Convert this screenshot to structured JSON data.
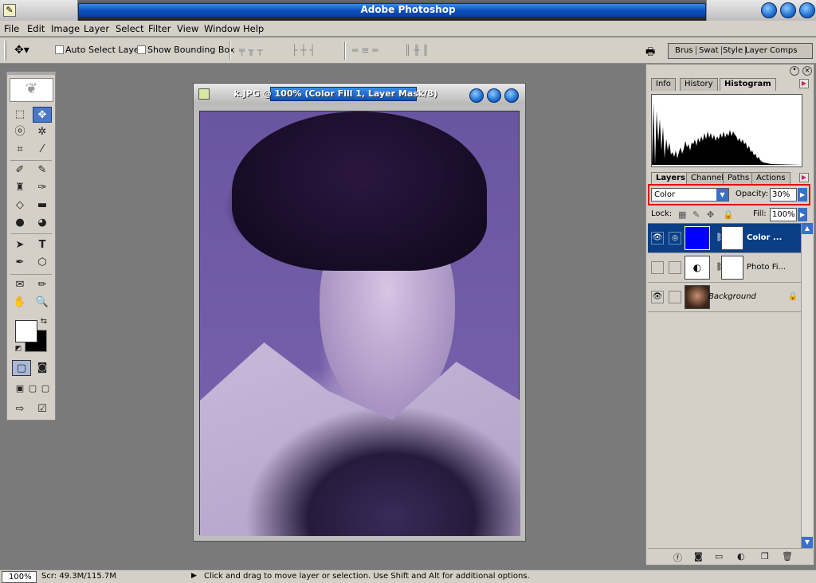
{
  "app": {
    "title": "Adobe Photoshop"
  },
  "menu": [
    "File",
    "Edit",
    "Image",
    "Layer",
    "Select",
    "Filter",
    "View",
    "Window",
    "Help"
  ],
  "options": {
    "auto_select_layer": "Auto Select Layer",
    "show_bounding_box": "Show Bounding Box"
  },
  "palette_well": [
    "Brus",
    "Swat",
    "Style",
    "Layer Comps"
  ],
  "document": {
    "title": "k.JPG @ 100% (Color Fill 1, Layer Mask/8)"
  },
  "info_panel": {
    "tabs": [
      "Info",
      "History",
      "Histogram"
    ],
    "active_tab": "Histogram"
  },
  "layers_panel": {
    "tabs": [
      "Layers",
      "Channels",
      "Paths",
      "Actions"
    ],
    "blend_mode": "Color",
    "opacity_label": "Opacity:",
    "opacity_value": "30%",
    "lock_label": "Lock:",
    "fill_label": "Fill:",
    "fill_value": "100%",
    "layers": [
      {
        "name": "Color ...",
        "selected": true,
        "visible": true
      },
      {
        "name": "Photo Fi...",
        "selected": false,
        "visible": false
      },
      {
        "name": "Background",
        "selected": false,
        "visible": true,
        "locked": true
      }
    ]
  },
  "status": {
    "zoom": "100%",
    "scratch": "Scr: 49.3M/115.7M",
    "hint": "Click and drag to move layer or selection.  Use Shift and Alt for additional options."
  },
  "colors": {
    "selected_layer": "#0a3f86",
    "fill_swatch": "#0000ff",
    "highlight_box": "#e01010"
  }
}
